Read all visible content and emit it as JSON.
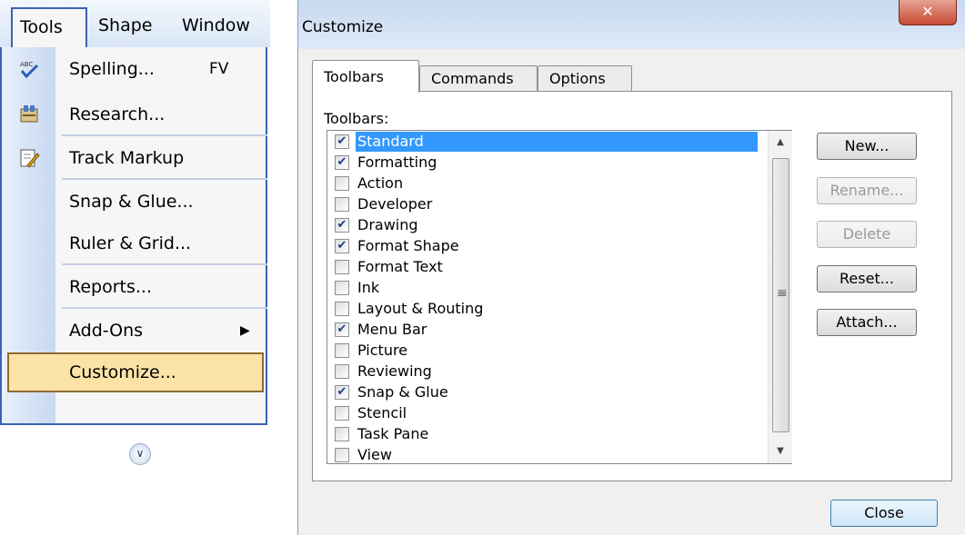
{
  "menubar": {
    "items": [
      {
        "label": "Tools"
      },
      {
        "label": "Shape"
      },
      {
        "label": "Window"
      }
    ]
  },
  "tools_menu": {
    "items": [
      {
        "label": "Spelling...",
        "shortcut": "FV",
        "icon": "spelling-icon"
      },
      {
        "label": "Research...",
        "icon": "research-icon"
      },
      {
        "label": "Track Markup",
        "icon": "track-markup-icon"
      },
      {
        "label": "Snap & Glue..."
      },
      {
        "label": "Ruler & Grid..."
      },
      {
        "label": "Reports..."
      },
      {
        "label": "Add-Ons"
      },
      {
        "label": "Customize..."
      }
    ],
    "expand_icon": "double-chevron-down-icon",
    "highlight_color": "#fbe3a7"
  },
  "dialog": {
    "title": "Customize",
    "tabs": [
      "Toolbars",
      "Commands",
      "Options"
    ],
    "active_tab": "Toolbars",
    "list_label": "Toolbars:",
    "toolbars": [
      {
        "label": "Standard",
        "checked": true,
        "selected": true
      },
      {
        "label": "Formatting",
        "checked": true
      },
      {
        "label": "Action",
        "checked": false
      },
      {
        "label": "Developer",
        "checked": false
      },
      {
        "label": "Drawing",
        "checked": true
      },
      {
        "label": "Format Shape",
        "checked": true
      },
      {
        "label": "Format Text",
        "checked": false
      },
      {
        "label": "Ink",
        "checked": false
      },
      {
        "label": "Layout & Routing",
        "checked": false
      },
      {
        "label": "Menu Bar",
        "checked": true
      },
      {
        "label": "Picture",
        "checked": false
      },
      {
        "label": "Reviewing",
        "checked": false
      },
      {
        "label": "Snap & Glue",
        "checked": true
      },
      {
        "label": "Stencil",
        "checked": false
      },
      {
        "label": "Task Pane",
        "checked": false
      },
      {
        "label": "View",
        "checked": false
      }
    ],
    "buttons": [
      {
        "label": "New...",
        "enabled": true
      },
      {
        "label": "Rename...",
        "enabled": false
      },
      {
        "label": "Delete",
        "enabled": false
      },
      {
        "label": "Reset...",
        "enabled": true
      },
      {
        "label": "Attach...",
        "enabled": true
      }
    ],
    "close_label": "Close",
    "selection_color": "#3399ff"
  }
}
